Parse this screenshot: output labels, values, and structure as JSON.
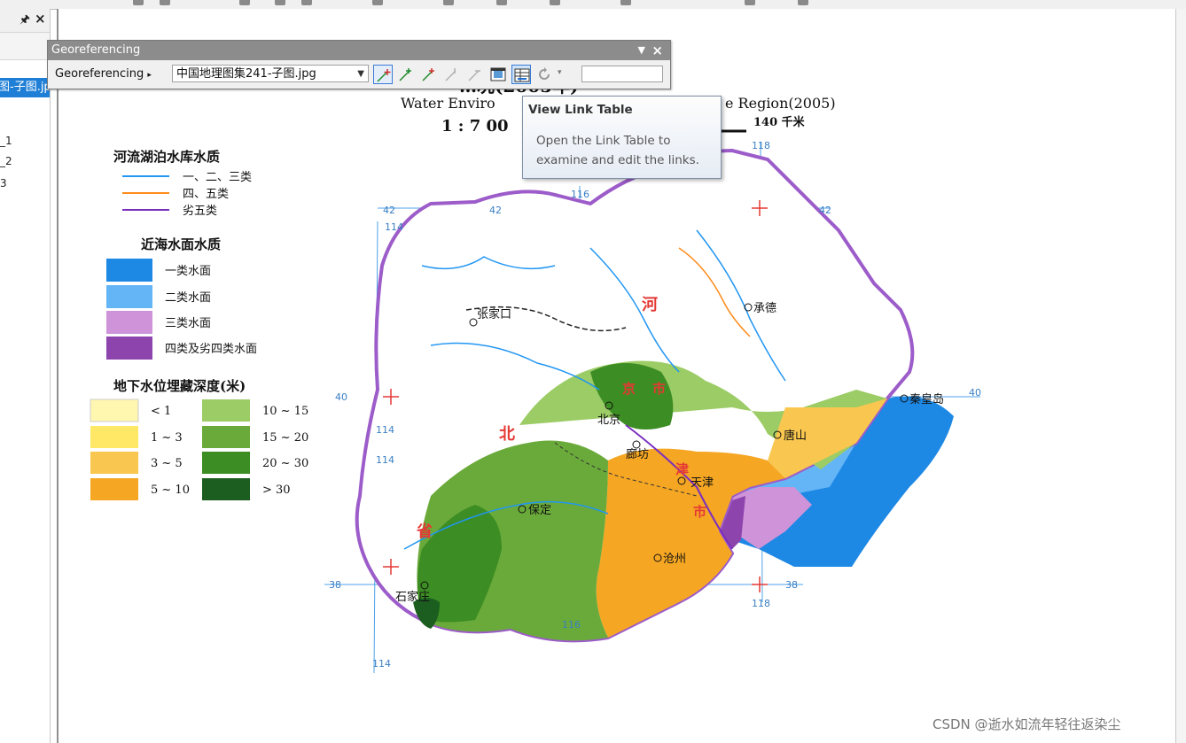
{
  "left_panel": {
    "selected_layer": "图-子图.jp",
    "items": [
      "_1",
      "_2",
      "3"
    ]
  },
  "georeferencing": {
    "window_title": "Georeferencing",
    "menu_label": "Georeferencing",
    "layer_combo": "中国地理图集241-子图.jpg",
    "rms_value": ""
  },
  "tooltip": {
    "title": "View Link Table",
    "body": "Open the Link Table to examine and edit the links."
  },
  "map": {
    "title_cn": "…况(2005年)",
    "title_en_left": "Water Enviro",
    "title_en_right": "e Region(2005)",
    "scale_text": "1 : 7 00",
    "scale_bar_label": "140 千米",
    "legend": {
      "river_title": "河流湖泊水库水质",
      "river_classes": [
        {
          "label": "一、二、三类",
          "color": "#2196f3"
        },
        {
          "label": "四、五类",
          "color": "#ff8c1a"
        },
        {
          "label": "劣五类",
          "color": "#7b2fbe"
        }
      ],
      "sea_title": "近海水面水质",
      "sea_classes": [
        {
          "label": "一类水面",
          "color": "#1e88e5"
        },
        {
          "label": "二类水面",
          "color": "#64b5f6"
        },
        {
          "label": "三类水面",
          "color": "#ce93d8"
        },
        {
          "label": "四类及劣四类水面",
          "color": "#8e44ad"
        }
      ],
      "ground_title": "地下水位埋藏深度(米)",
      "ground_classes": [
        {
          "label": "< 1",
          "color": "#fff6b0"
        },
        {
          "label": "1 ~ 3",
          "color": "#ffe866"
        },
        {
          "label": "3 ~ 5",
          "color": "#f9c74f"
        },
        {
          "label": "5 ~ 10",
          "color": "#f5a623"
        },
        {
          "label": "10 ~ 15",
          "color": "#9ccc65"
        },
        {
          "label": "15 ~ 20",
          "color": "#6aaa3a"
        },
        {
          "label": "20 ~ 30",
          "color": "#3c8d23"
        },
        {
          "label": "> 30",
          "color": "#1b5e20"
        }
      ]
    },
    "places": [
      "张家口",
      "承德",
      "北京",
      "廊坊",
      "天津",
      "唐山",
      "秦皇岛",
      "保定",
      "沧州",
      "石家庄"
    ],
    "region_labels": [
      "河",
      "北",
      "省",
      "京",
      "市",
      "津",
      "市"
    ],
    "grid_labels": [
      "42",
      "42",
      "42",
      "40",
      "40",
      "38",
      "38",
      "114",
      "114",
      "114",
      "114",
      "116",
      "116",
      "118",
      "118"
    ]
  },
  "watermark": "CSDN @逝水如流年轻往返染尘"
}
